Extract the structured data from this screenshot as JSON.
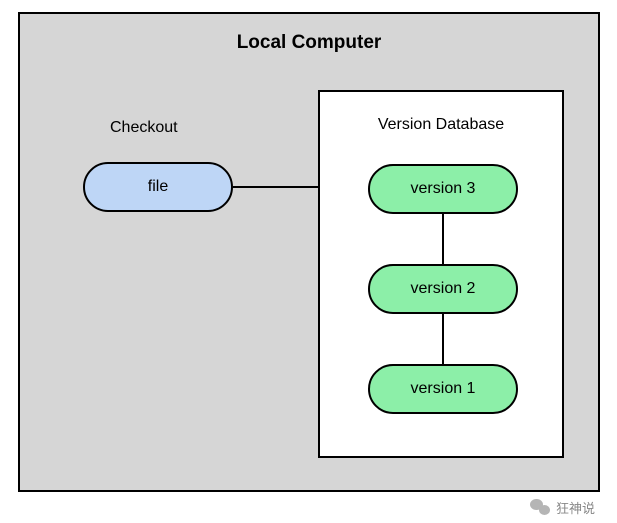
{
  "diagram": {
    "title": "Local Computer",
    "checkout": {
      "label": "Checkout",
      "file_label": "file"
    },
    "database": {
      "label": "Version Database",
      "versions": {
        "v3": "version 3",
        "v2": "version 2",
        "v1": "version 1"
      }
    }
  },
  "watermark": {
    "text": "狂神说",
    "icon": "wechat-icon"
  },
  "colors": {
    "outer_bg": "#d6d6d6",
    "file_node": "#bed6f6",
    "version_node": "#8cefa8",
    "border": "#000000",
    "db_bg": "#ffffff"
  }
}
